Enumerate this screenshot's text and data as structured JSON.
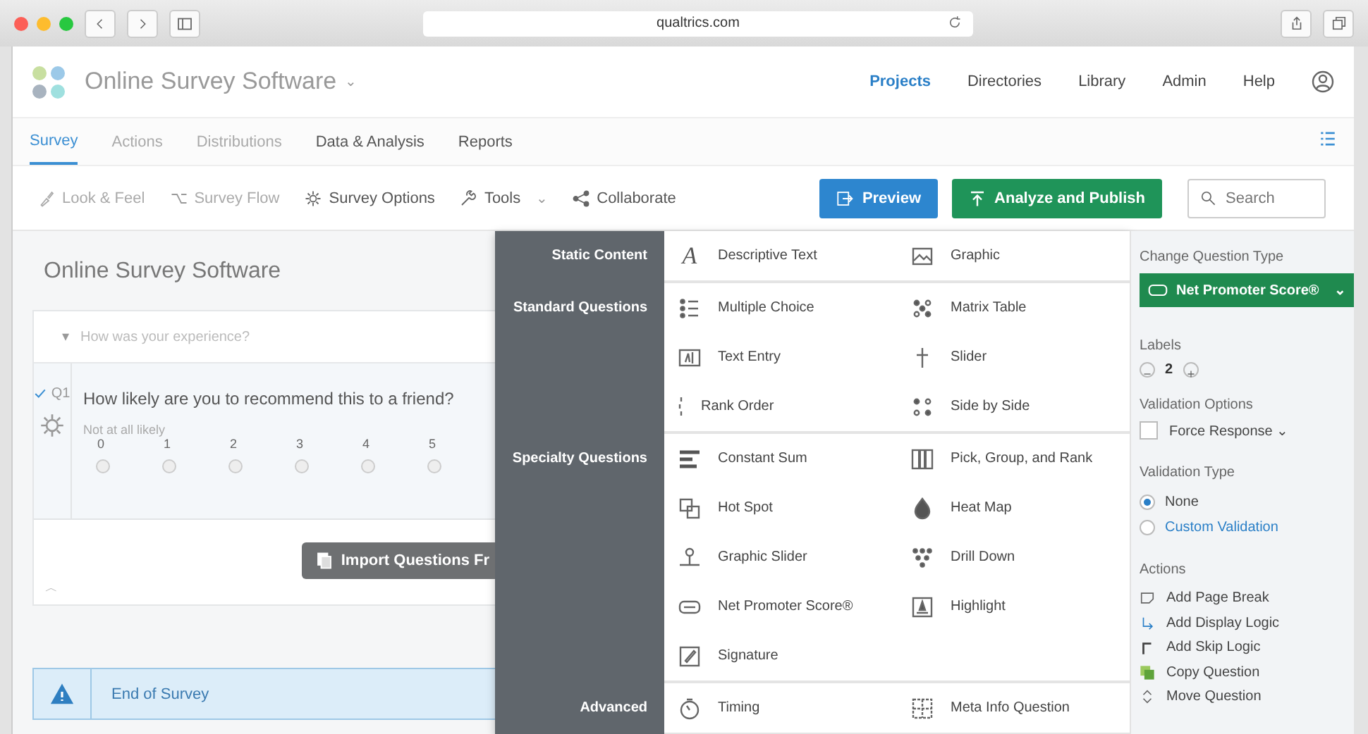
{
  "browser": {
    "url": "qualtrics.com"
  },
  "header": {
    "project_title": "Online Survey Software",
    "title_caret": "⌄",
    "nav": [
      {
        "label": "Projects",
        "selected": true
      },
      {
        "label": "Directories",
        "selected": false
      },
      {
        "label": "Library",
        "selected": false
      },
      {
        "label": "Admin",
        "selected": false
      },
      {
        "label": "Help",
        "selected": false
      }
    ]
  },
  "tabs": [
    {
      "label": "Survey",
      "selected": true,
      "disabled": false
    },
    {
      "label": "Actions",
      "selected": false,
      "disabled": true
    },
    {
      "label": "Distributions",
      "selected": false,
      "disabled": true
    },
    {
      "label": "Data & Analysis",
      "selected": false,
      "disabled": false
    },
    {
      "label": "Reports",
      "selected": false,
      "disabled": false
    }
  ],
  "toolbar": {
    "items": [
      {
        "label": "Look & Feel",
        "disabled": true
      },
      {
        "label": "Survey Flow",
        "disabled": true
      },
      {
        "label": "Survey Options",
        "disabled": false
      },
      {
        "label": "Tools",
        "disabled": false,
        "caret": "⌄"
      },
      {
        "label": "Collaborate",
        "disabled": false
      }
    ],
    "preview": "Preview",
    "publish": "Analyze and Publish",
    "search_placeholder": "Search"
  },
  "survey": {
    "title": "Online Survey Software",
    "block_caret": "▾",
    "block_title": "How was your experience?",
    "question": {
      "number": "Q1",
      "text": "How likely are you to recommend this to a friend?",
      "scale_label": "Not at all likely",
      "options": [
        {
          "label": "0",
          "selected": false
        },
        {
          "label": "1",
          "selected": false
        },
        {
          "label": "2",
          "selected": false
        },
        {
          "label": "3",
          "selected": false
        },
        {
          "label": "4",
          "selected": false
        },
        {
          "label": "5",
          "selected": false
        }
      ]
    },
    "import_button": "Import Questions Fr",
    "collapse_caret": "︿",
    "end_label": "End of Survey"
  },
  "insert_menu": {
    "sections": [
      {
        "title": "Static Content",
        "glyph": "A",
        "items": [
          "Descriptive Text",
          "Graphic"
        ]
      },
      {
        "title": "Standard Questions",
        "items": [
          "Multiple Choice",
          "Matrix Table",
          "Text Entry",
          "Slider",
          "Rank Order",
          "Side by Side"
        ]
      },
      {
        "title": "Specialty Questions",
        "items": [
          "Constant Sum",
          "Pick, Group, and Rank",
          "Hot Spot",
          "Heat Map",
          "Graphic Slider",
          "Drill Down",
          "Net Promoter Score®",
          "Highlight",
          "Signature"
        ]
      },
      {
        "title": "Advanced",
        "items": [
          "Timing",
          "Meta Info Question"
        ]
      }
    ]
  },
  "panel": {
    "change_type": {
      "heading": "Change Question Type",
      "value": "Net Promoter Score®",
      "caret": "⌄"
    },
    "labels": {
      "heading": "Labels",
      "value": "2"
    },
    "validation_options": {
      "heading": "Validation Options",
      "force_response": {
        "label": "Force Response",
        "caret": "⌄",
        "checked": false
      }
    },
    "validation_type": {
      "heading": "Validation Type",
      "options": [
        {
          "label": "None",
          "selected": true
        },
        {
          "label": "Custom Validation",
          "selected": false
        }
      ]
    },
    "actions": {
      "heading": "Actions",
      "items": [
        "Add Page Break",
        "Add Display Logic",
        "Add Skip Logic",
        "Copy Question",
        "Move Question"
      ]
    }
  }
}
